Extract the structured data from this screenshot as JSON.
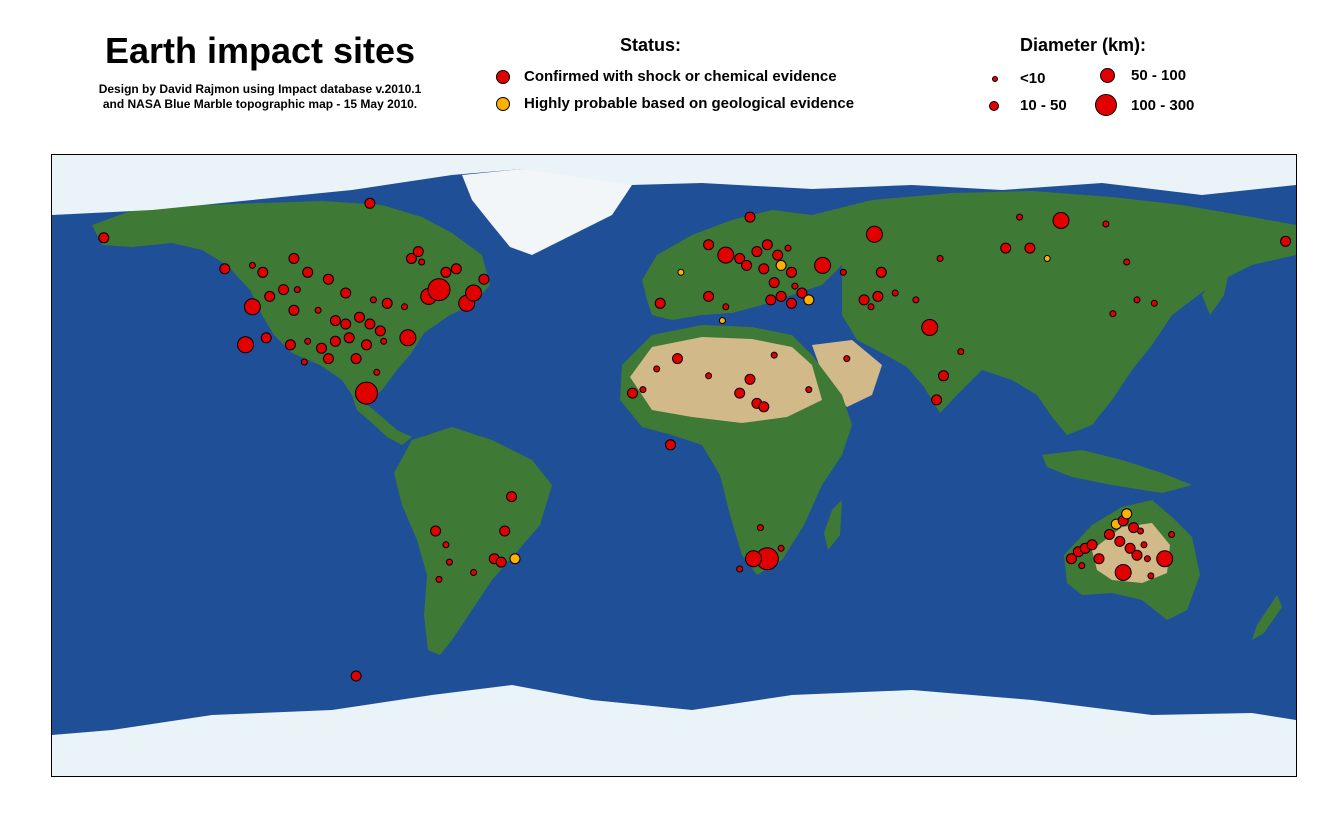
{
  "header": {
    "title": "Earth impact sites",
    "credit_line1": "Design by David Rajmon using Impact database v.2010.1",
    "credit_line2": "and NASA Blue Marble topographic map - 15 May 2010."
  },
  "legend": {
    "status_title": "Status:",
    "status_items": [
      {
        "label": "Confirmed with shock or chemical evidence",
        "color": "#e00000"
      },
      {
        "label": "Highly probable based on geological evidence",
        "color": "#ffb000"
      }
    ],
    "diameter_title": "Diameter (km):",
    "diameter_items": [
      {
        "label": "<10"
      },
      {
        "label": "10 - 50"
      },
      {
        "label": "50 - 100"
      },
      {
        "label": "100 - 300"
      }
    ]
  },
  "colors": {
    "ocean": "#1f4f97",
    "land": "#3e7a35",
    "desert": "#d2b98a",
    "ice": "#e9f3f8",
    "confirmed": "#e00000",
    "probable": "#ffb000"
  },
  "map": {
    "projection": "equirectangular",
    "sites": [
      {
        "lon": -165,
        "lat": 66,
        "status": "confirmed",
        "size_class": "10 - 50"
      },
      {
        "lon": -88,
        "lat": 76,
        "status": "confirmed",
        "size_class": "10 - 50"
      },
      {
        "lon": -130,
        "lat": 57,
        "status": "confirmed",
        "size_class": "10 - 50"
      },
      {
        "lon": -122,
        "lat": 58,
        "status": "confirmed",
        "size_class": "<10"
      },
      {
        "lon": -119,
        "lat": 56,
        "status": "confirmed",
        "size_class": "10 - 50"
      },
      {
        "lon": -110,
        "lat": 60,
        "status": "confirmed",
        "size_class": "10 - 50"
      },
      {
        "lon": -106,
        "lat": 56,
        "status": "confirmed",
        "size_class": "10 - 50"
      },
      {
        "lon": -100,
        "lat": 54,
        "status": "confirmed",
        "size_class": "10 - 50"
      },
      {
        "lon": -95,
        "lat": 50,
        "status": "confirmed",
        "size_class": "10 - 50"
      },
      {
        "lon": -87,
        "lat": 48,
        "status": "confirmed",
        "size_class": "<10"
      },
      {
        "lon": -83,
        "lat": 47,
        "status": "confirmed",
        "size_class": "10 - 50"
      },
      {
        "lon": -78,
        "lat": 46,
        "status": "confirmed",
        "size_class": "<10"
      },
      {
        "lon": -71,
        "lat": 49,
        "status": "confirmed",
        "size_class": "50 - 100"
      },
      {
        "lon": -68,
        "lat": 51,
        "status": "confirmed",
        "size_class": "100 - 300"
      },
      {
        "lon": -60,
        "lat": 47,
        "status": "confirmed",
        "size_class": "50 - 100"
      },
      {
        "lon": -58,
        "lat": 50,
        "status": "confirmed",
        "size_class": "50 - 100"
      },
      {
        "lon": -55,
        "lat": 54,
        "status": "confirmed",
        "size_class": "10 - 50"
      },
      {
        "lon": -63,
        "lat": 57,
        "status": "confirmed",
        "size_class": "10 - 50"
      },
      {
        "lon": -73,
        "lat": 59,
        "status": "confirmed",
        "size_class": "<10"
      },
      {
        "lon": -76,
        "lat": 60,
        "status": "confirmed",
        "size_class": "10 - 50"
      },
      {
        "lon": -74,
        "lat": 62,
        "status": "confirmed",
        "size_class": "10 - 50"
      },
      {
        "lon": -66,
        "lat": 56,
        "status": "confirmed",
        "size_class": "10 - 50"
      },
      {
        "lon": -117,
        "lat": 49,
        "status": "confirmed",
        "size_class": "10 - 50"
      },
      {
        "lon": -113,
        "lat": 51,
        "status": "confirmed",
        "size_class": "10 - 50"
      },
      {
        "lon": -109,
        "lat": 51,
        "status": "confirmed",
        "size_class": "<10"
      },
      {
        "lon": -122,
        "lat": 46,
        "status": "confirmed",
        "size_class": "50 - 100"
      },
      {
        "lon": -110,
        "lat": 45,
        "status": "confirmed",
        "size_class": "10 - 50"
      },
      {
        "lon": -103,
        "lat": 45,
        "status": "confirmed",
        "size_class": "<10"
      },
      {
        "lon": -98,
        "lat": 42,
        "status": "confirmed",
        "size_class": "10 - 50"
      },
      {
        "lon": -95,
        "lat": 41,
        "status": "confirmed",
        "size_class": "10 - 50"
      },
      {
        "lon": -91,
        "lat": 43,
        "status": "confirmed",
        "size_class": "10 - 50"
      },
      {
        "lon": -88,
        "lat": 41,
        "status": "confirmed",
        "size_class": "10 - 50"
      },
      {
        "lon": -85,
        "lat": 39,
        "status": "confirmed",
        "size_class": "10 - 50"
      },
      {
        "lon": -124,
        "lat": 35,
        "status": "confirmed",
        "size_class": "50 - 100"
      },
      {
        "lon": -118,
        "lat": 37,
        "status": "confirmed",
        "size_class": "10 - 50"
      },
      {
        "lon": -111,
        "lat": 35,
        "status": "confirmed",
        "size_class": "10 - 50"
      },
      {
        "lon": -106,
        "lat": 36,
        "status": "confirmed",
        "size_class": "<10"
      },
      {
        "lon": -102,
        "lat": 34,
        "status": "confirmed",
        "size_class": "10 - 50"
      },
      {
        "lon": -98,
        "lat": 36,
        "status": "confirmed",
        "size_class": "10 - 50"
      },
      {
        "lon": -94,
        "lat": 37,
        "status": "confirmed",
        "size_class": "10 - 50"
      },
      {
        "lon": -89,
        "lat": 35,
        "status": "confirmed",
        "size_class": "10 - 50"
      },
      {
        "lon": -84,
        "lat": 36,
        "status": "confirmed",
        "size_class": "<10"
      },
      {
        "lon": -77,
        "lat": 37,
        "status": "confirmed",
        "size_class": "50 - 100"
      },
      {
        "lon": -100,
        "lat": 31,
        "status": "confirmed",
        "size_class": "10 - 50"
      },
      {
        "lon": -107,
        "lat": 30,
        "status": "confirmed",
        "size_class": "<10"
      },
      {
        "lon": -92,
        "lat": 31,
        "status": "confirmed",
        "size_class": "10 - 50"
      },
      {
        "lon": -89,
        "lat": 21,
        "status": "confirmed",
        "size_class": "100 - 300"
      },
      {
        "lon": -86,
        "lat": 27,
        "status": "confirmed",
        "size_class": "<10"
      },
      {
        "lon": 22,
        "lat": 72,
        "status": "confirmed",
        "size_class": "10 - 50"
      },
      {
        "lon": 10,
        "lat": 64,
        "status": "confirmed",
        "size_class": "10 - 50"
      },
      {
        "lon": 15,
        "lat": 61,
        "status": "confirmed",
        "size_class": "50 - 100"
      },
      {
        "lon": 19,
        "lat": 60,
        "status": "confirmed",
        "size_class": "10 - 50"
      },
      {
        "lon": 24,
        "lat": 62,
        "status": "confirmed",
        "size_class": "10 - 50"
      },
      {
        "lon": 27,
        "lat": 64,
        "status": "confirmed",
        "size_class": "10 - 50"
      },
      {
        "lon": 30,
        "lat": 61,
        "status": "confirmed",
        "size_class": "10 - 50"
      },
      {
        "lon": 33,
        "lat": 63,
        "status": "confirmed",
        "size_class": "<10"
      },
      {
        "lon": 21,
        "lat": 58,
        "status": "confirmed",
        "size_class": "10 - 50"
      },
      {
        "lon": 26,
        "lat": 57,
        "status": "confirmed",
        "size_class": "10 - 50"
      },
      {
        "lon": 31,
        "lat": 58,
        "status": "probable",
        "size_class": "10 - 50"
      },
      {
        "lon": 34,
        "lat": 56,
        "status": "confirmed",
        "size_class": "10 - 50"
      },
      {
        "lon": 43,
        "lat": 58,
        "status": "confirmed",
        "size_class": "50 - 100"
      },
      {
        "lon": 49,
        "lat": 56,
        "status": "confirmed",
        "size_class": "<10"
      },
      {
        "lon": 60,
        "lat": 56,
        "status": "confirmed",
        "size_class": "10 - 50"
      },
      {
        "lon": 2,
        "lat": 56,
        "status": "probable",
        "size_class": "<10"
      },
      {
        "lon": -4,
        "lat": 47,
        "status": "confirmed",
        "size_class": "10 - 50"
      },
      {
        "lon": 10,
        "lat": 49,
        "status": "confirmed",
        "size_class": "10 - 50"
      },
      {
        "lon": 15,
        "lat": 46,
        "status": "confirmed",
        "size_class": "<10"
      },
      {
        "lon": 14,
        "lat": 42,
        "status": "probable",
        "size_class": "<10"
      },
      {
        "lon": 28,
        "lat": 48,
        "status": "confirmed",
        "size_class": "10 - 50"
      },
      {
        "lon": 31,
        "lat": 49,
        "status": "confirmed",
        "size_class": "10 - 50"
      },
      {
        "lon": 34,
        "lat": 47,
        "status": "confirmed",
        "size_class": "10 - 50"
      },
      {
        "lon": 37,
        "lat": 50,
        "status": "confirmed",
        "size_class": "10 - 50"
      },
      {
        "lon": 39,
        "lat": 48,
        "status": "probable",
        "size_class": "10 - 50"
      },
      {
        "lon": 35,
        "lat": 52,
        "status": "confirmed",
        "size_class": "<10"
      },
      {
        "lon": 29,
        "lat": 53,
        "status": "confirmed",
        "size_class": "10 - 50"
      },
      {
        "lon": 55,
        "lat": 48,
        "status": "confirmed",
        "size_class": "10 - 50"
      },
      {
        "lon": 59,
        "lat": 49,
        "status": "confirmed",
        "size_class": "10 - 50"
      },
      {
        "lon": 64,
        "lat": 50,
        "status": "confirmed",
        "size_class": "<10"
      },
      {
        "lon": 57,
        "lat": 46,
        "status": "confirmed",
        "size_class": "<10"
      },
      {
        "lon": 70,
        "lat": 48,
        "status": "confirmed",
        "size_class": "<10"
      },
      {
        "lon": 74,
        "lat": 40,
        "status": "confirmed",
        "size_class": "50 - 100"
      },
      {
        "lon": 58,
        "lat": 67,
        "status": "confirmed",
        "size_class": "50 - 100"
      },
      {
        "lon": 77,
        "lat": 60,
        "status": "confirmed",
        "size_class": "<10"
      },
      {
        "lon": 100,
        "lat": 72,
        "status": "confirmed",
        "size_class": "<10"
      },
      {
        "lon": 112,
        "lat": 71,
        "status": "confirmed",
        "size_class": "50 - 100"
      },
      {
        "lon": 125,
        "lat": 70,
        "status": "confirmed",
        "size_class": "<10"
      },
      {
        "lon": 96,
        "lat": 63,
        "status": "confirmed",
        "size_class": "10 - 50"
      },
      {
        "lon": 103,
        "lat": 63,
        "status": "confirmed",
        "size_class": "10 - 50"
      },
      {
        "lon": 108,
        "lat": 60,
        "status": "probable",
        "size_class": "<10"
      },
      {
        "lon": 131,
        "lat": 59,
        "status": "confirmed",
        "size_class": "<10"
      },
      {
        "lon": 177,
        "lat": 65,
        "status": "confirmed",
        "size_class": "10 - 50"
      },
      {
        "lon": 139,
        "lat": 47,
        "status": "confirmed",
        "size_class": "<10"
      },
      {
        "lon": 127,
        "lat": 44,
        "status": "confirmed",
        "size_class": "<10"
      },
      {
        "lon": 134,
        "lat": 48,
        "status": "confirmed",
        "size_class": "<10"
      },
      {
        "lon": 78,
        "lat": 26,
        "status": "confirmed",
        "size_class": "10 - 50"
      },
      {
        "lon": 76,
        "lat": 19,
        "status": "confirmed",
        "size_class": "10 - 50"
      },
      {
        "lon": 83,
        "lat": 33,
        "status": "confirmed",
        "size_class": "<10"
      },
      {
        "lon": 1,
        "lat": 31,
        "status": "confirmed",
        "size_class": "10 - 50"
      },
      {
        "lon": -5,
        "lat": 28,
        "status": "confirmed",
        "size_class": "<10"
      },
      {
        "lon": -12,
        "lat": 21,
        "status": "confirmed",
        "size_class": "10 - 50"
      },
      {
        "lon": -9,
        "lat": 22,
        "status": "confirmed",
        "size_class": "<10"
      },
      {
        "lon": 10,
        "lat": 26,
        "status": "confirmed",
        "size_class": "<10"
      },
      {
        "lon": 22,
        "lat": 25,
        "status": "confirmed",
        "size_class": "10 - 50"
      },
      {
        "lon": 19,
        "lat": 21,
        "status": "confirmed",
        "size_class": "10 - 50"
      },
      {
        "lon": 24,
        "lat": 18,
        "status": "confirmed",
        "size_class": "10 - 50"
      },
      {
        "lon": 26,
        "lat": 17,
        "status": "confirmed",
        "size_class": "10 - 50"
      },
      {
        "lon": 29,
        "lat": 32,
        "status": "confirmed",
        "size_class": "<10"
      },
      {
        "lon": 39,
        "lat": 22,
        "status": "confirmed",
        "size_class": "<10"
      },
      {
        "lon": 50,
        "lat": 31,
        "status": "confirmed",
        "size_class": "<10"
      },
      {
        "lon": -1,
        "lat": 6,
        "status": "confirmed",
        "size_class": "10 - 50"
      },
      {
        "lon": 27,
        "lat": -27,
        "status": "confirmed",
        "size_class": "100 - 300"
      },
      {
        "lon": 23,
        "lat": -27,
        "status": "confirmed",
        "size_class": "50 - 100"
      },
      {
        "lon": 19,
        "lat": -30,
        "status": "confirmed",
        "size_class": "<10"
      },
      {
        "lon": 31,
        "lat": -24,
        "status": "confirmed",
        "size_class": "<10"
      },
      {
        "lon": 25,
        "lat": -18,
        "status": "confirmed",
        "size_class": "<10"
      },
      {
        "lon": -47,
        "lat": -9,
        "status": "confirmed",
        "size_class": "10 - 50"
      },
      {
        "lon": -49,
        "lat": -19,
        "status": "confirmed",
        "size_class": "10 - 50"
      },
      {
        "lon": -69,
        "lat": -19,
        "status": "confirmed",
        "size_class": "10 - 50"
      },
      {
        "lon": -66,
        "lat": -23,
        "status": "confirmed",
        "size_class": "<10"
      },
      {
        "lon": -65,
        "lat": -28,
        "status": "confirmed",
        "size_class": "<10"
      },
      {
        "lon": -68,
        "lat": -33,
        "status": "confirmed",
        "size_class": "<10"
      },
      {
        "lon": -52,
        "lat": -27,
        "status": "confirmed",
        "size_class": "10 - 50"
      },
      {
        "lon": -50,
        "lat": -28,
        "status": "confirmed",
        "size_class": "10 - 50"
      },
      {
        "lon": -46,
        "lat": -27,
        "status": "probable",
        "size_class": "10 - 50"
      },
      {
        "lon": -58,
        "lat": -31,
        "status": "confirmed",
        "size_class": "<10"
      },
      {
        "lon": -92,
        "lat": -61,
        "status": "confirmed",
        "size_class": "10 - 50"
      },
      {
        "lon": 115,
        "lat": -27,
        "status": "confirmed",
        "size_class": "10 - 50"
      },
      {
        "lon": 117,
        "lat": -25,
        "status": "confirmed",
        "size_class": "10 - 50"
      },
      {
        "lon": 119,
        "lat": -24,
        "status": "confirmed",
        "size_class": "10 - 50"
      },
      {
        "lon": 121,
        "lat": -23,
        "status": "confirmed",
        "size_class": "10 - 50"
      },
      {
        "lon": 118,
        "lat": -29,
        "status": "confirmed",
        "size_class": "<10"
      },
      {
        "lon": 123,
        "lat": -27,
        "status": "confirmed",
        "size_class": "10 - 50"
      },
      {
        "lon": 126,
        "lat": -20,
        "status": "confirmed",
        "size_class": "10 - 50"
      },
      {
        "lon": 128,
        "lat": -17,
        "status": "probable",
        "size_class": "10 - 50"
      },
      {
        "lon": 130,
        "lat": -16,
        "status": "confirmed",
        "size_class": "10 - 50"
      },
      {
        "lon": 131,
        "lat": -14,
        "status": "probable",
        "size_class": "10 - 50"
      },
      {
        "lon": 133,
        "lat": -18,
        "status": "confirmed",
        "size_class": "10 - 50"
      },
      {
        "lon": 135,
        "lat": -19,
        "status": "confirmed",
        "size_class": "<10"
      },
      {
        "lon": 129,
        "lat": -22,
        "status": "confirmed",
        "size_class": "10 - 50"
      },
      {
        "lon": 132,
        "lat": -24,
        "status": "confirmed",
        "size_class": "10 - 50"
      },
      {
        "lon": 136,
        "lat": -23,
        "status": "confirmed",
        "size_class": "<10"
      },
      {
        "lon": 134,
        "lat": -26,
        "status": "confirmed",
        "size_class": "10 - 50"
      },
      {
        "lon": 130,
        "lat": -31,
        "status": "confirmed",
        "size_class": "50 - 100"
      },
      {
        "lon": 137,
        "lat": -27,
        "status": "confirmed",
        "size_class": "<10"
      },
      {
        "lon": 138,
        "lat": -32,
        "status": "confirmed",
        "size_class": "<10"
      },
      {
        "lon": 142,
        "lat": -27,
        "status": "confirmed",
        "size_class": "50 - 100"
      },
      {
        "lon": 144,
        "lat": -20,
        "status": "confirmed",
        "size_class": "<10"
      }
    ]
  }
}
